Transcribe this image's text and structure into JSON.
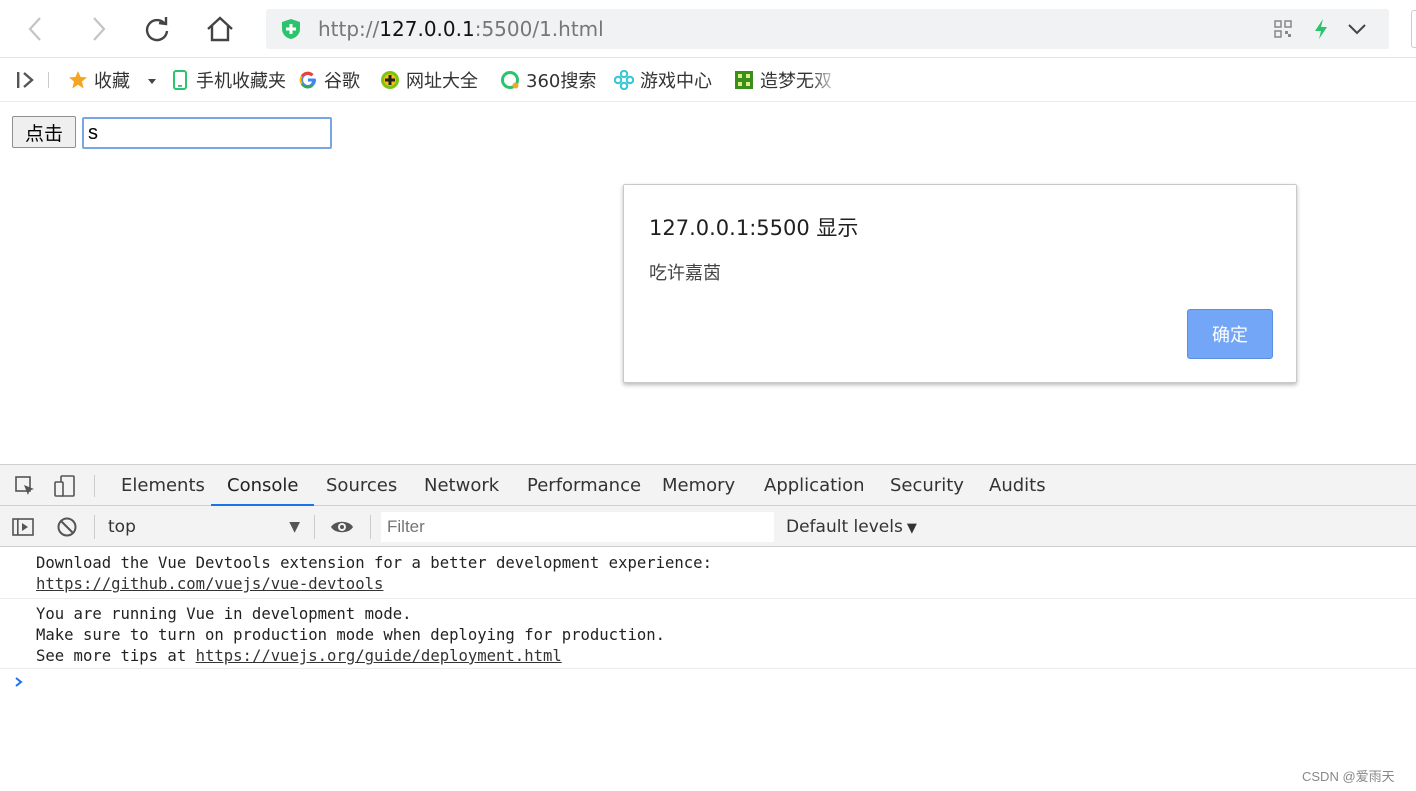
{
  "browser": {
    "url_scheme": "http://",
    "url_host": "127.0.0.1",
    "url_rest": ":5500/1.html",
    "accent_color": "#2bc36b"
  },
  "bookmarks": [
    {
      "label": "收藏",
      "icon": "star-icon"
    },
    {
      "label": "手机收藏夹",
      "icon": "phone-icon"
    },
    {
      "label": "谷歌",
      "icon": "google-icon"
    },
    {
      "label": "网址大全",
      "icon": "web-directory-icon"
    },
    {
      "label": "360搜索",
      "icon": "search-360-icon"
    },
    {
      "label": "游戏中心",
      "icon": "game-center-icon"
    },
    {
      "label": "造梦无双",
      "icon": "game-logo-icon"
    }
  ],
  "page": {
    "button_label": "点击",
    "input_value": "s"
  },
  "alert": {
    "title": "127.0.0.1:5500 显示",
    "message": "吃许嘉茵",
    "ok_label": "确定",
    "ok_color": "#73a6f6"
  },
  "devtools": {
    "tabs": [
      "Elements",
      "Console",
      "Sources",
      "Network",
      "Performance",
      "Memory",
      "Application",
      "Security",
      "Audits"
    ],
    "active_tab": "Console",
    "context": "top",
    "filter_placeholder": "Filter",
    "levels_label": "Default levels",
    "messages": [
      {
        "lines": [
          "Download the Vue Devtools extension for a better development experience:"
        ],
        "link": "https://github.com/vuejs/vue-devtools"
      },
      {
        "lines": [
          "You are running Vue in development mode.",
          "Make sure to turn on production mode when deploying for production."
        ],
        "prefix": "See more tips at ",
        "link": "https://vuejs.org/guide/deployment.html"
      }
    ]
  },
  "watermark": "CSDN @爱雨天"
}
